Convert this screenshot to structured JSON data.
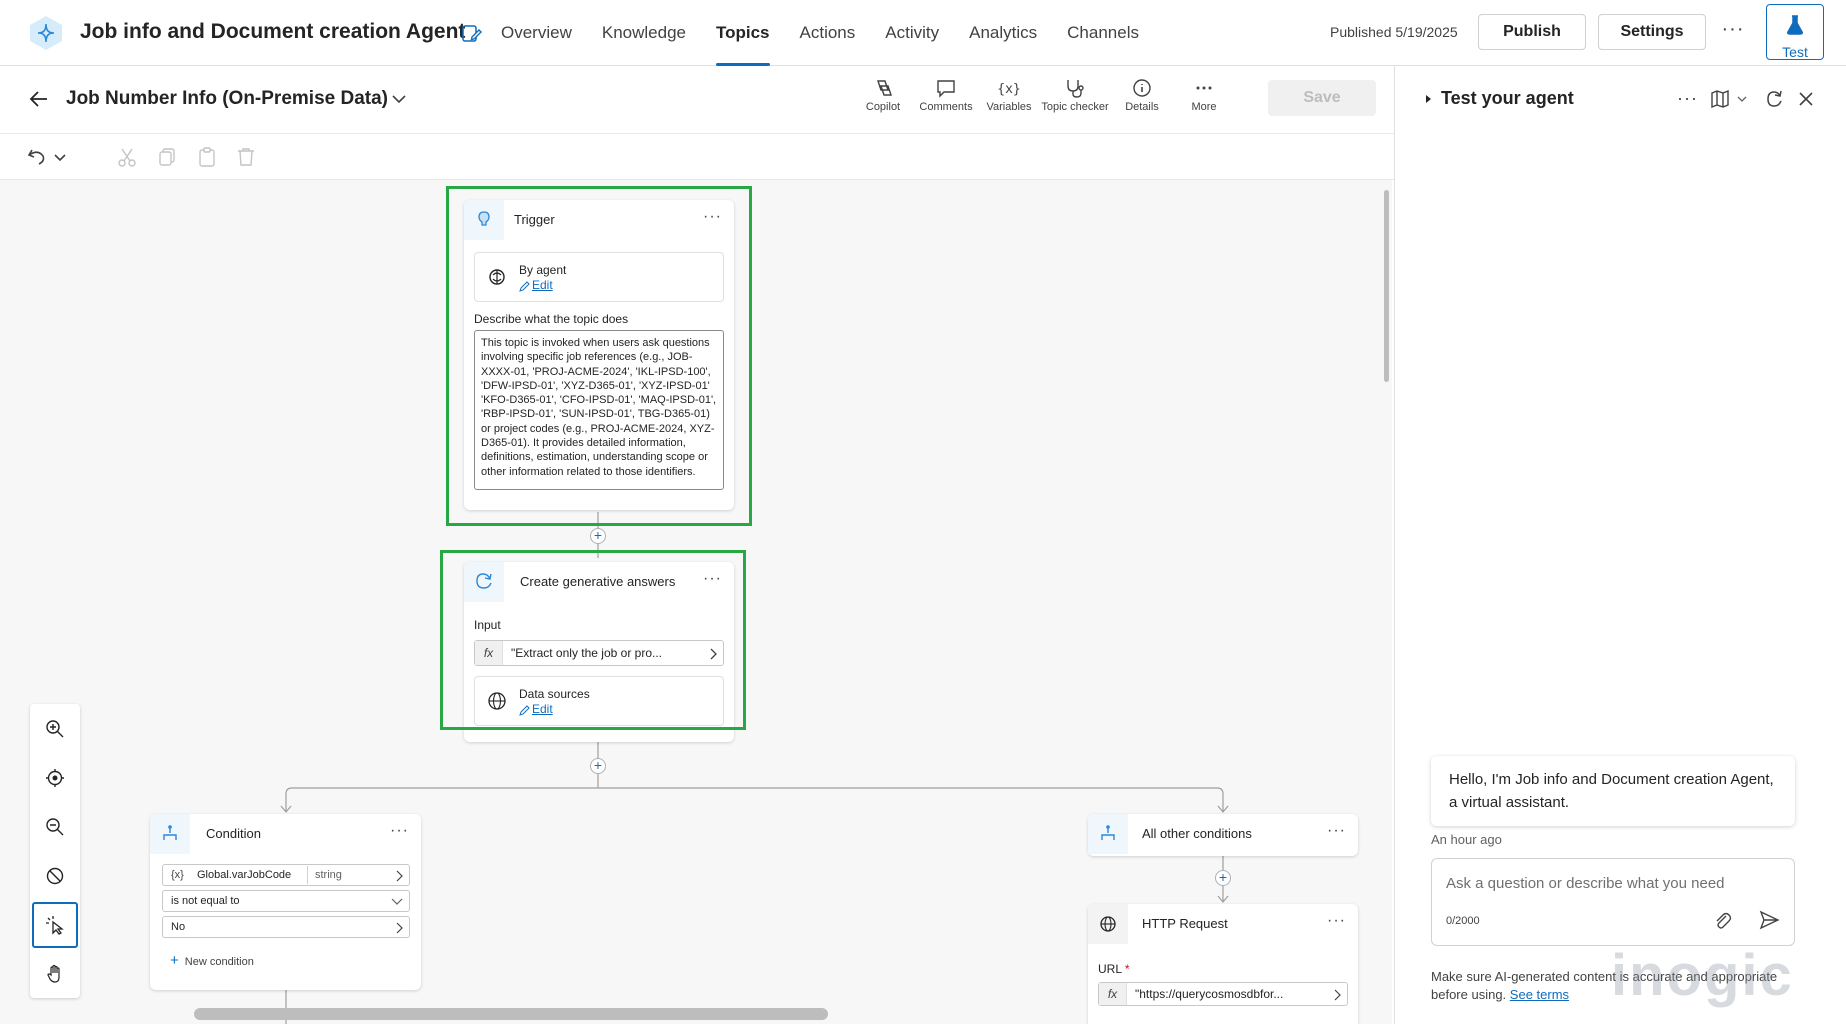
{
  "app": {
    "title": "Job info and Document creation Agent",
    "published": "Published 5/19/2025",
    "publish_label": "Publish",
    "settings_label": "Settings",
    "test_label": "Test"
  },
  "nav": {
    "tabs": [
      {
        "label": "Overview"
      },
      {
        "label": "Knowledge"
      },
      {
        "label": "Topics",
        "active": true
      },
      {
        "label": "Actions"
      },
      {
        "label": "Activity"
      },
      {
        "label": "Analytics"
      },
      {
        "label": "Channels"
      }
    ]
  },
  "topic": {
    "title": "Job Number Info (On-Premise Data)",
    "save_label": "Save",
    "tools": [
      {
        "label": "Copilot",
        "icon": "copilot-icon"
      },
      {
        "label": "Comments",
        "icon": "comment-icon"
      },
      {
        "label": "Variables",
        "icon": "variables-icon"
      },
      {
        "label": "Topic checker",
        "icon": "stethoscope-icon"
      },
      {
        "label": "Details",
        "icon": "info-icon"
      },
      {
        "label": "More",
        "icon": "more-icon"
      }
    ]
  },
  "trigger": {
    "title": "Trigger",
    "by_agent": "By agent",
    "edit": "Edit",
    "describe_label": "Describe what the topic does",
    "description": "This topic is invoked when users ask questions involving specific job references (e.g., JOB-XXXX-01, 'PROJ-ACME-2024', 'IKL-IPSD-100', 'DFW-IPSD-01', 'XYZ-D365-01', 'XYZ-IPSD-01' 'KFO-D365-01', 'CFO-IPSD-01', 'MAQ-IPSD-01', 'RBP-IPSD-01', 'SUN-IPSD-01', TBG-D365-01) or project codes (e.g., PROJ-ACME-2024, XYZ-D365-01). It provides detailed information, definitions, estimation, understanding scope or other information related to those identifiers."
  },
  "generative": {
    "title": "Create generative answers",
    "input_label": "Input",
    "fx": "fx",
    "input_value": "\"Extract only the job or pro...",
    "data_sources": "Data sources",
    "edit": "Edit"
  },
  "condition": {
    "title": "Condition",
    "var_prefix": "{x}",
    "variable": "Global.varJobCode",
    "type": "string",
    "operator": "is not equal to",
    "value": "No",
    "new_condition": "New condition"
  },
  "other": {
    "title": "All other conditions"
  },
  "http": {
    "title": "HTTP Request",
    "url_label": "URL",
    "required": "*",
    "fx": "fx",
    "url_value": "\"https://querycosmosdbfor..."
  },
  "test_panel": {
    "title": "Test your agent",
    "greeting": "Hello, I'm Job info and Document creation Agent, a virtual assistant.",
    "time": "An hour ago",
    "placeholder": "Ask a question or describe what you need",
    "count": "0/2000",
    "disclaimer": "Make sure AI-generated content is accurate and appropriate before using.",
    "see_terms": "See terms"
  },
  "watermark": "inogic",
  "colors": {
    "accent": "#0f6cbd",
    "highlight": "#28a745"
  }
}
